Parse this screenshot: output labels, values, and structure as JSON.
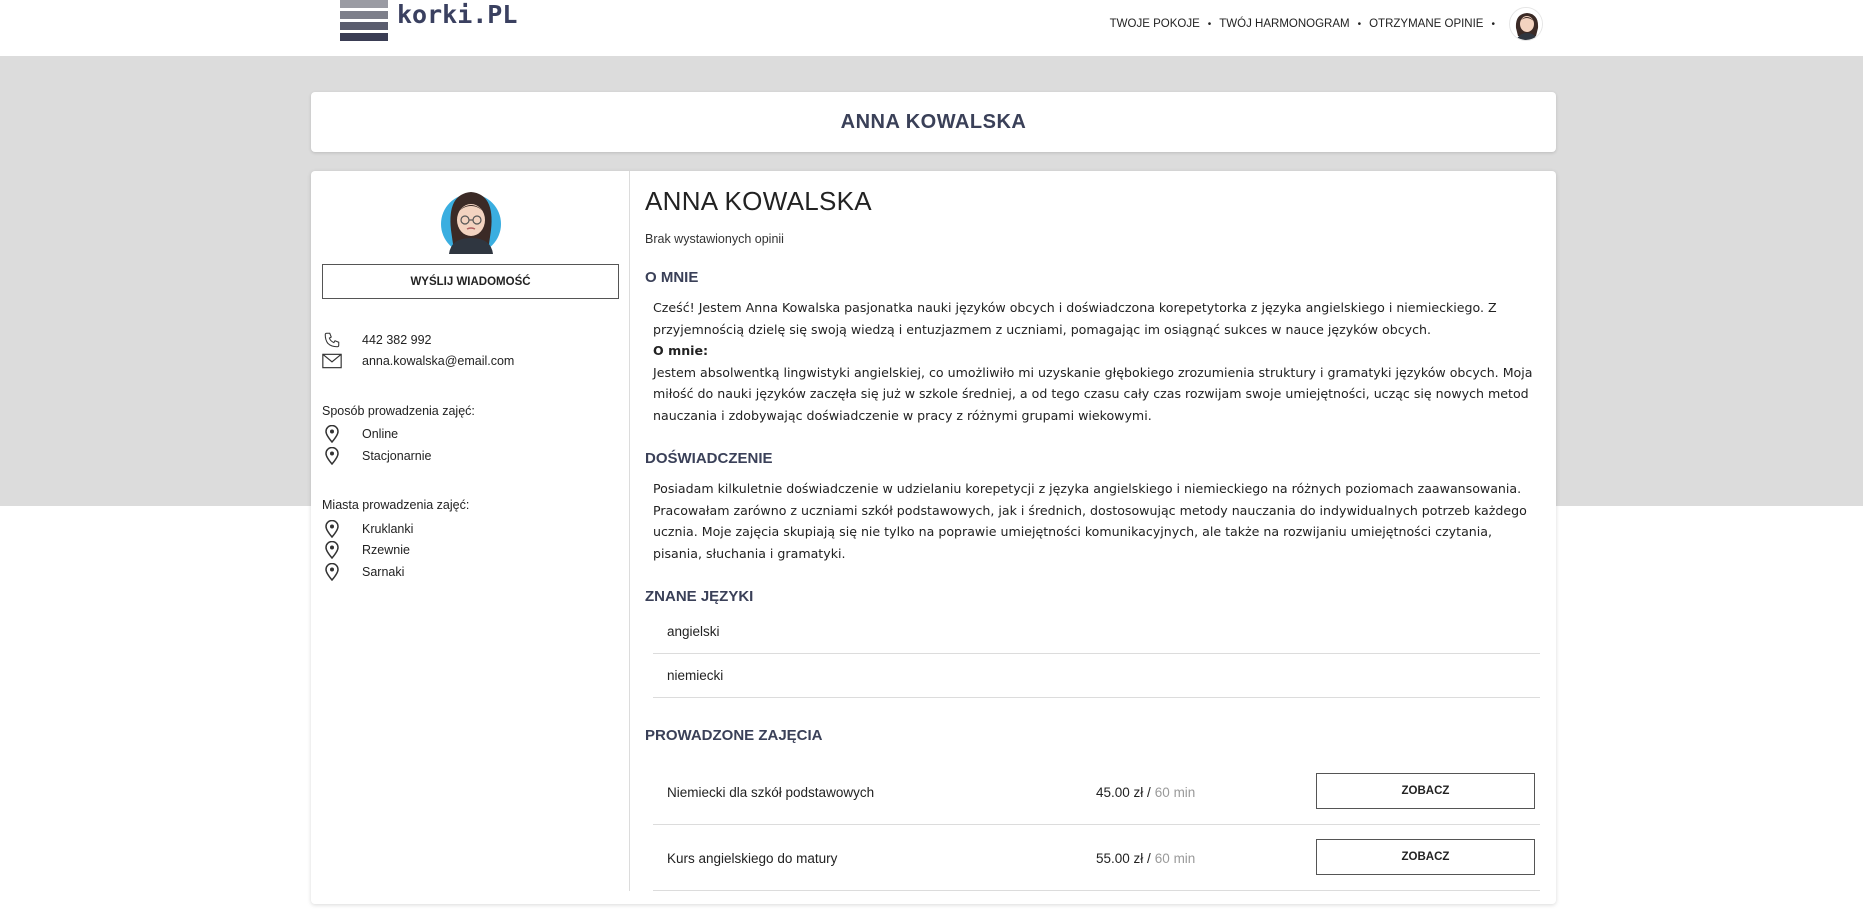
{
  "brand": {
    "name": "korki.PL",
    "bar_colors": [
      "#9a9ba3",
      "#7d7f8a",
      "#5a5d6e",
      "#3a3d54"
    ]
  },
  "nav": {
    "items": [
      {
        "label": "TWOJE POKOJE"
      },
      {
        "label": "TWÓJ HARMONOGRAM"
      },
      {
        "label": "OTRZYMANE OPINIE"
      }
    ],
    "separator": "•",
    "avatar_icon": "user-avatar-icon"
  },
  "title_card": {
    "title": "ANNA KOWALSKA"
  },
  "profile": {
    "name": "ANNA KOWALSKA",
    "avatar_icon": "teacher-avatar-icon",
    "message_button": "WYŚLIJ WIADOMOŚĆ",
    "phone": "442 382 992",
    "email": "anna.kowalska@email.com",
    "phone_icon": "phone-icon",
    "email_icon": "mail-icon",
    "mode_label": "Sposób prowadzenia zajęć:",
    "modes": [
      "Online",
      "Stacjonarnie"
    ],
    "cities_label": "Miasta prowadzenia zajęć:",
    "cities": [
      "Kruklanki",
      "Rzewnie",
      "Sarnaki"
    ],
    "pin_icon": "location-pin-icon"
  },
  "reviews": {
    "text": "Brak wystawionych opinii"
  },
  "about": {
    "heading": "O MNIE",
    "intro": "Cześć! Jestem Anna Kowalska pasjonatka nauki języków obcych i doświadczona korepetytorka z języka angielskiego i niemieckiego. Z przyjemnością dzielę się swoją wiedzą i entuzjazmem z uczniami, pomagając im osiągnąć sukces w nauce języków obcych.",
    "subheading": "O mnie:",
    "body": "Jestem absolwentką lingwistyki angielskiej, co umożliwiło mi uzyskanie głębokiego zrozumienia struktury i gramatyki języków obcych. Moja miłość do nauki języków zaczęła się już w szkole średniej, a od tego czasu cały czas rozwijam swoje umiejętności, ucząc się nowych metod nauczania i zdobywając doświadczenie w pracy z różnymi grupami wiekowymi."
  },
  "experience": {
    "heading": "DOŚWIADCZENIE",
    "text": "Posiadam kilkuletnie doświadczenie w udzielaniu korepetycji z języka angielskiego i niemieckiego na różnych poziomach zaawansowania. Pracowałam zarówno z uczniami szkół podstawowych, jak i średnich, dostosowując metody nauczania do indywidualnych potrzeb każdego ucznia. Moje zajęcia skupiają się nie tylko na poprawie umiejętności komunikacyjnych, ale także na rozwijaniu umiejętności czytania, pisania, słuchania i gramatyki."
  },
  "languages": {
    "heading": "ZNANE JĘZYKI",
    "items": [
      "angielski",
      "niemiecki"
    ]
  },
  "courses": {
    "heading": "PROWADZONE ZAJĘCIA",
    "items": [
      {
        "name": "Niemiecki dla szkół podstawowych",
        "price": "45.00 zł /",
        "duration": "60 min",
        "button": "ZOBACZ"
      },
      {
        "name": "Kurs angielskiego do matury",
        "price": "55.00 zł /",
        "duration": "60 min",
        "button": "ZOBACZ"
      }
    ]
  },
  "colors": {
    "heading": "#3a4058",
    "background_band": "#dcdcdc",
    "muted": "#9a9a9a"
  }
}
